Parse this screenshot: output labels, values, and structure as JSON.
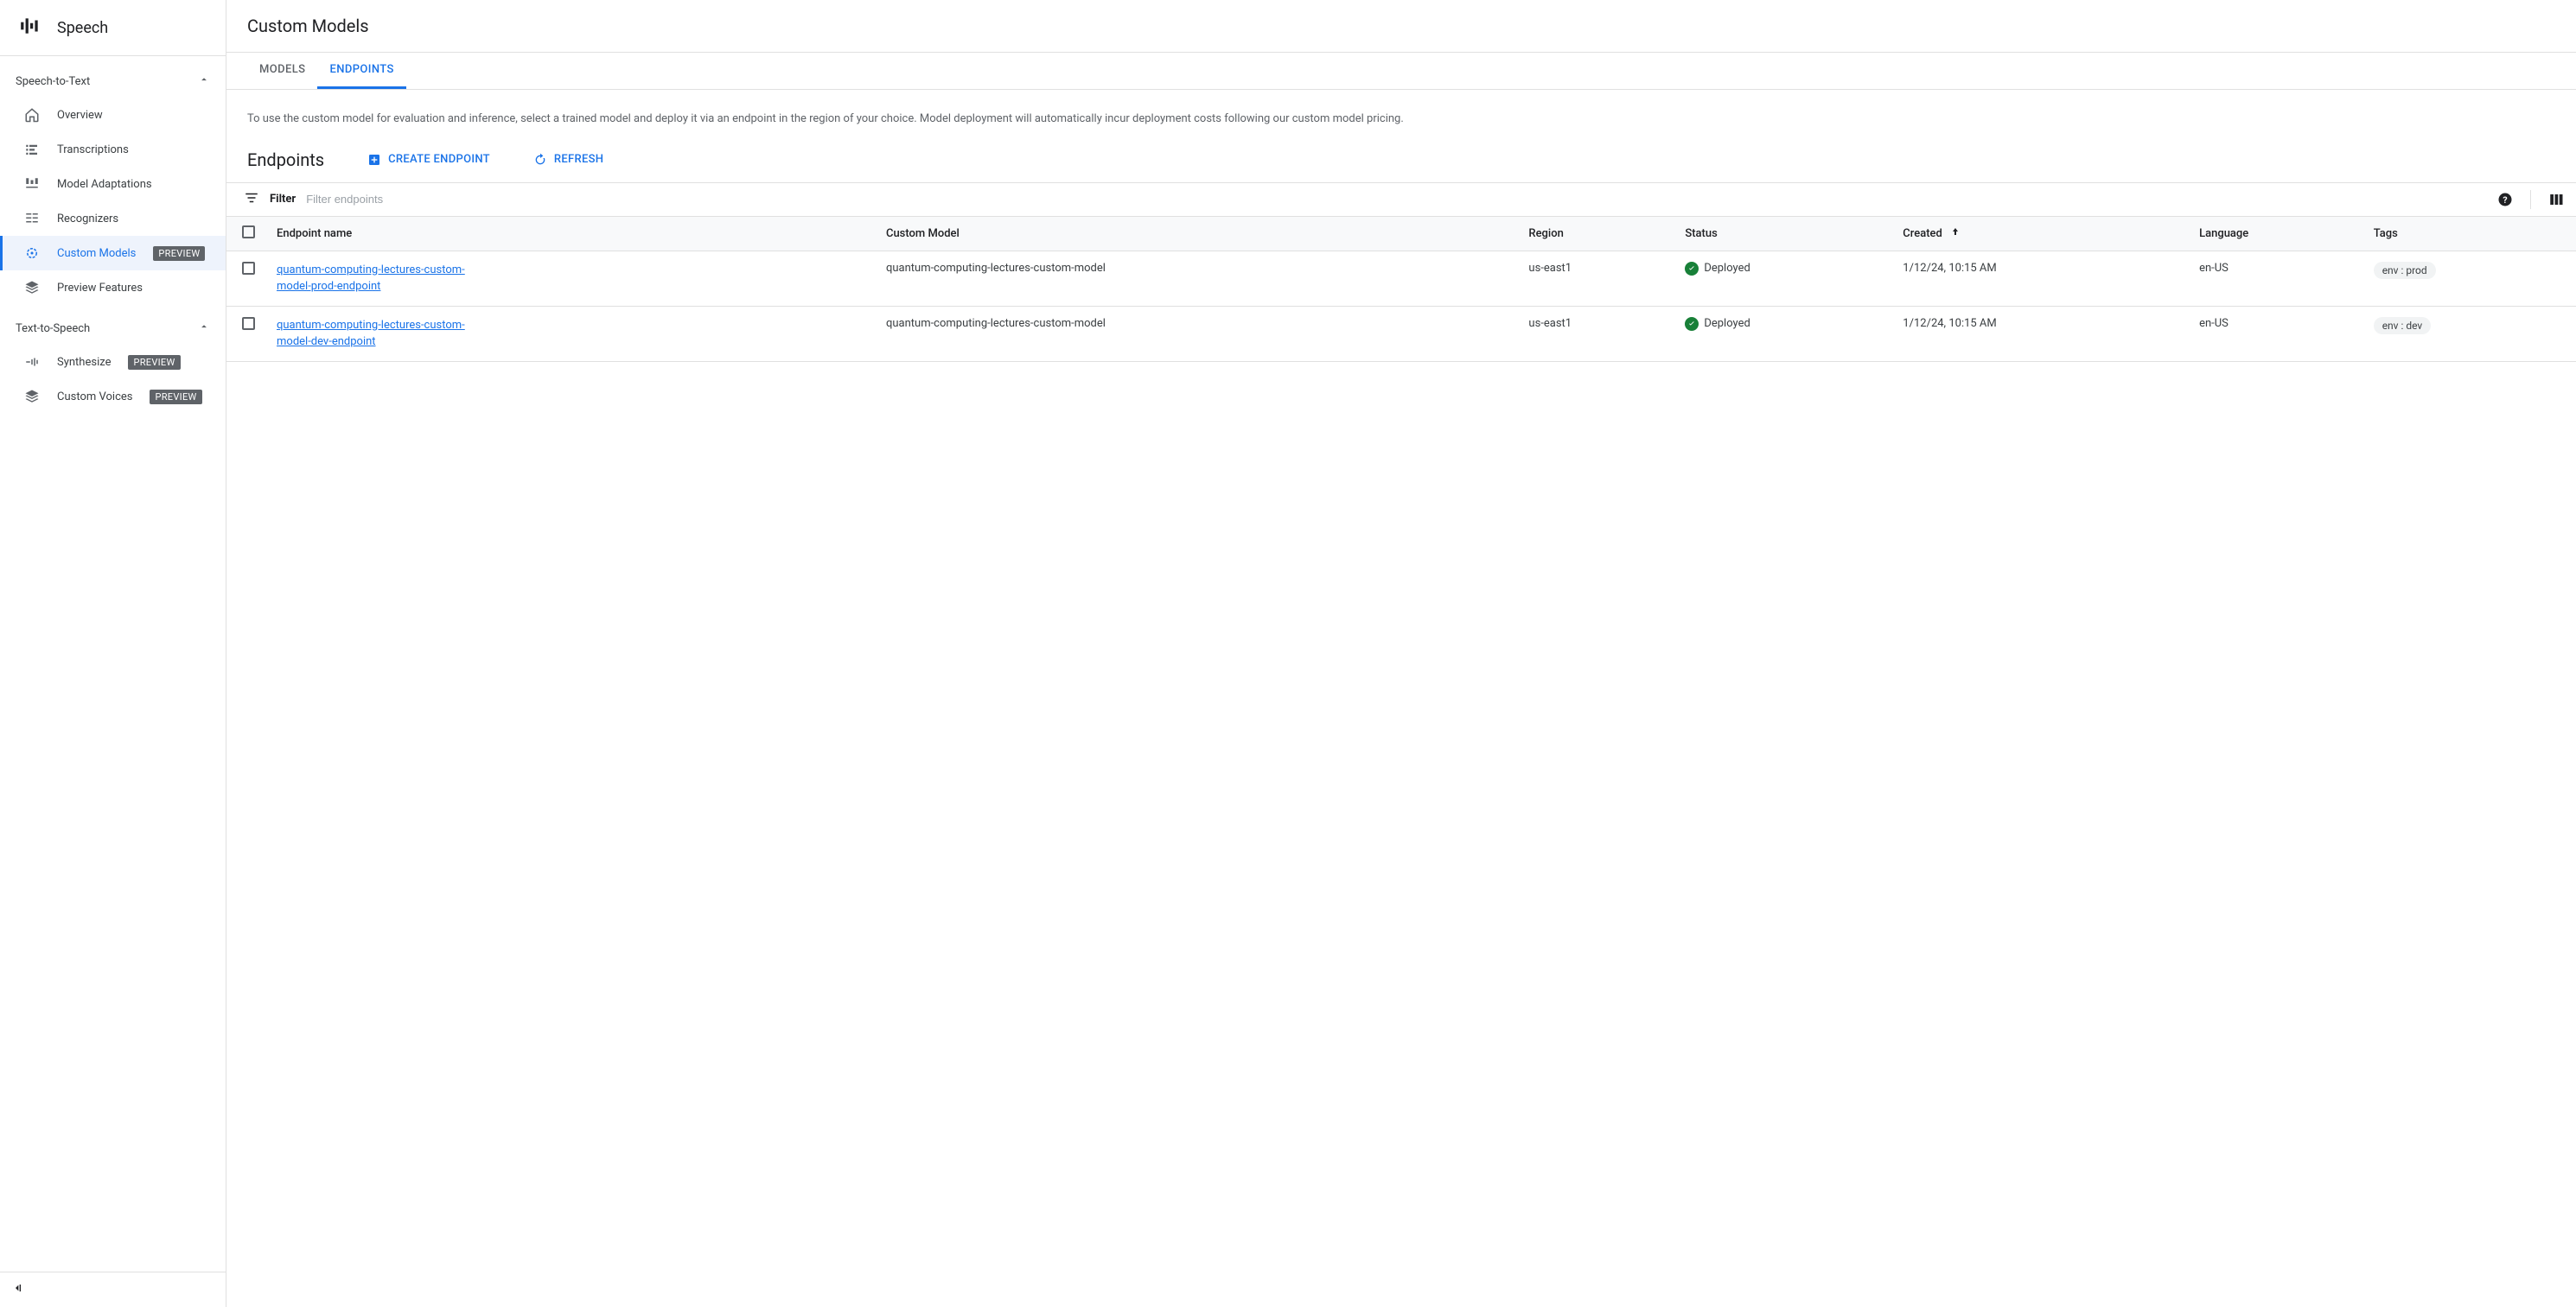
{
  "sidebar": {
    "title": "Speech",
    "sections": [
      {
        "header": "Speech-to-Text",
        "items": [
          {
            "label": "Overview",
            "active": false
          },
          {
            "label": "Transcriptions",
            "active": false
          },
          {
            "label": "Model Adaptations",
            "active": false
          },
          {
            "label": "Recognizers",
            "active": false
          },
          {
            "label": "Custom Models",
            "active": true,
            "preview": "PREVIEW"
          },
          {
            "label": "Preview Features",
            "active": false
          }
        ]
      },
      {
        "header": "Text-to-Speech",
        "items": [
          {
            "label": "Synthesize",
            "preview": "PREVIEW"
          },
          {
            "label": "Custom Voices",
            "preview": "PREVIEW"
          }
        ]
      }
    ]
  },
  "main": {
    "title": "Custom Models",
    "tabs": [
      {
        "label": "MODELS",
        "active": false
      },
      {
        "label": "ENDPOINTS",
        "active": true
      }
    ],
    "description": "To use the custom model for evaluation and inference, select a trained model and deploy it via an endpoint in the region of your choice. Model deployment will automatically incur deployment costs following our custom model pricing.",
    "section_title": "Endpoints",
    "actions": {
      "create": "CREATE ENDPOINT",
      "refresh": "REFRESH"
    },
    "filter": {
      "label": "Filter",
      "placeholder": "Filter endpoints"
    },
    "table": {
      "headers": {
        "endpoint": "Endpoint name",
        "model": "Custom Model",
        "region": "Region",
        "status": "Status",
        "created": "Created",
        "language": "Language",
        "tags": "Tags"
      },
      "rows": [
        {
          "endpoint": "quantum-computing-lectures-custom-model-prod-endpoint",
          "model": "quantum-computing-lectures-custom-model",
          "region": "us-east1",
          "status": "Deployed",
          "created": "1/12/24, 10:15 AM",
          "language": "en-US",
          "tag": "env : prod"
        },
        {
          "endpoint": "quantum-computing-lectures-custom-model-dev-endpoint",
          "model": "quantum-computing-lectures-custom-model",
          "region": "us-east1",
          "status": "Deployed",
          "created": "1/12/24, 10:15 AM",
          "language": "en-US",
          "tag": "env : dev"
        }
      ]
    }
  }
}
